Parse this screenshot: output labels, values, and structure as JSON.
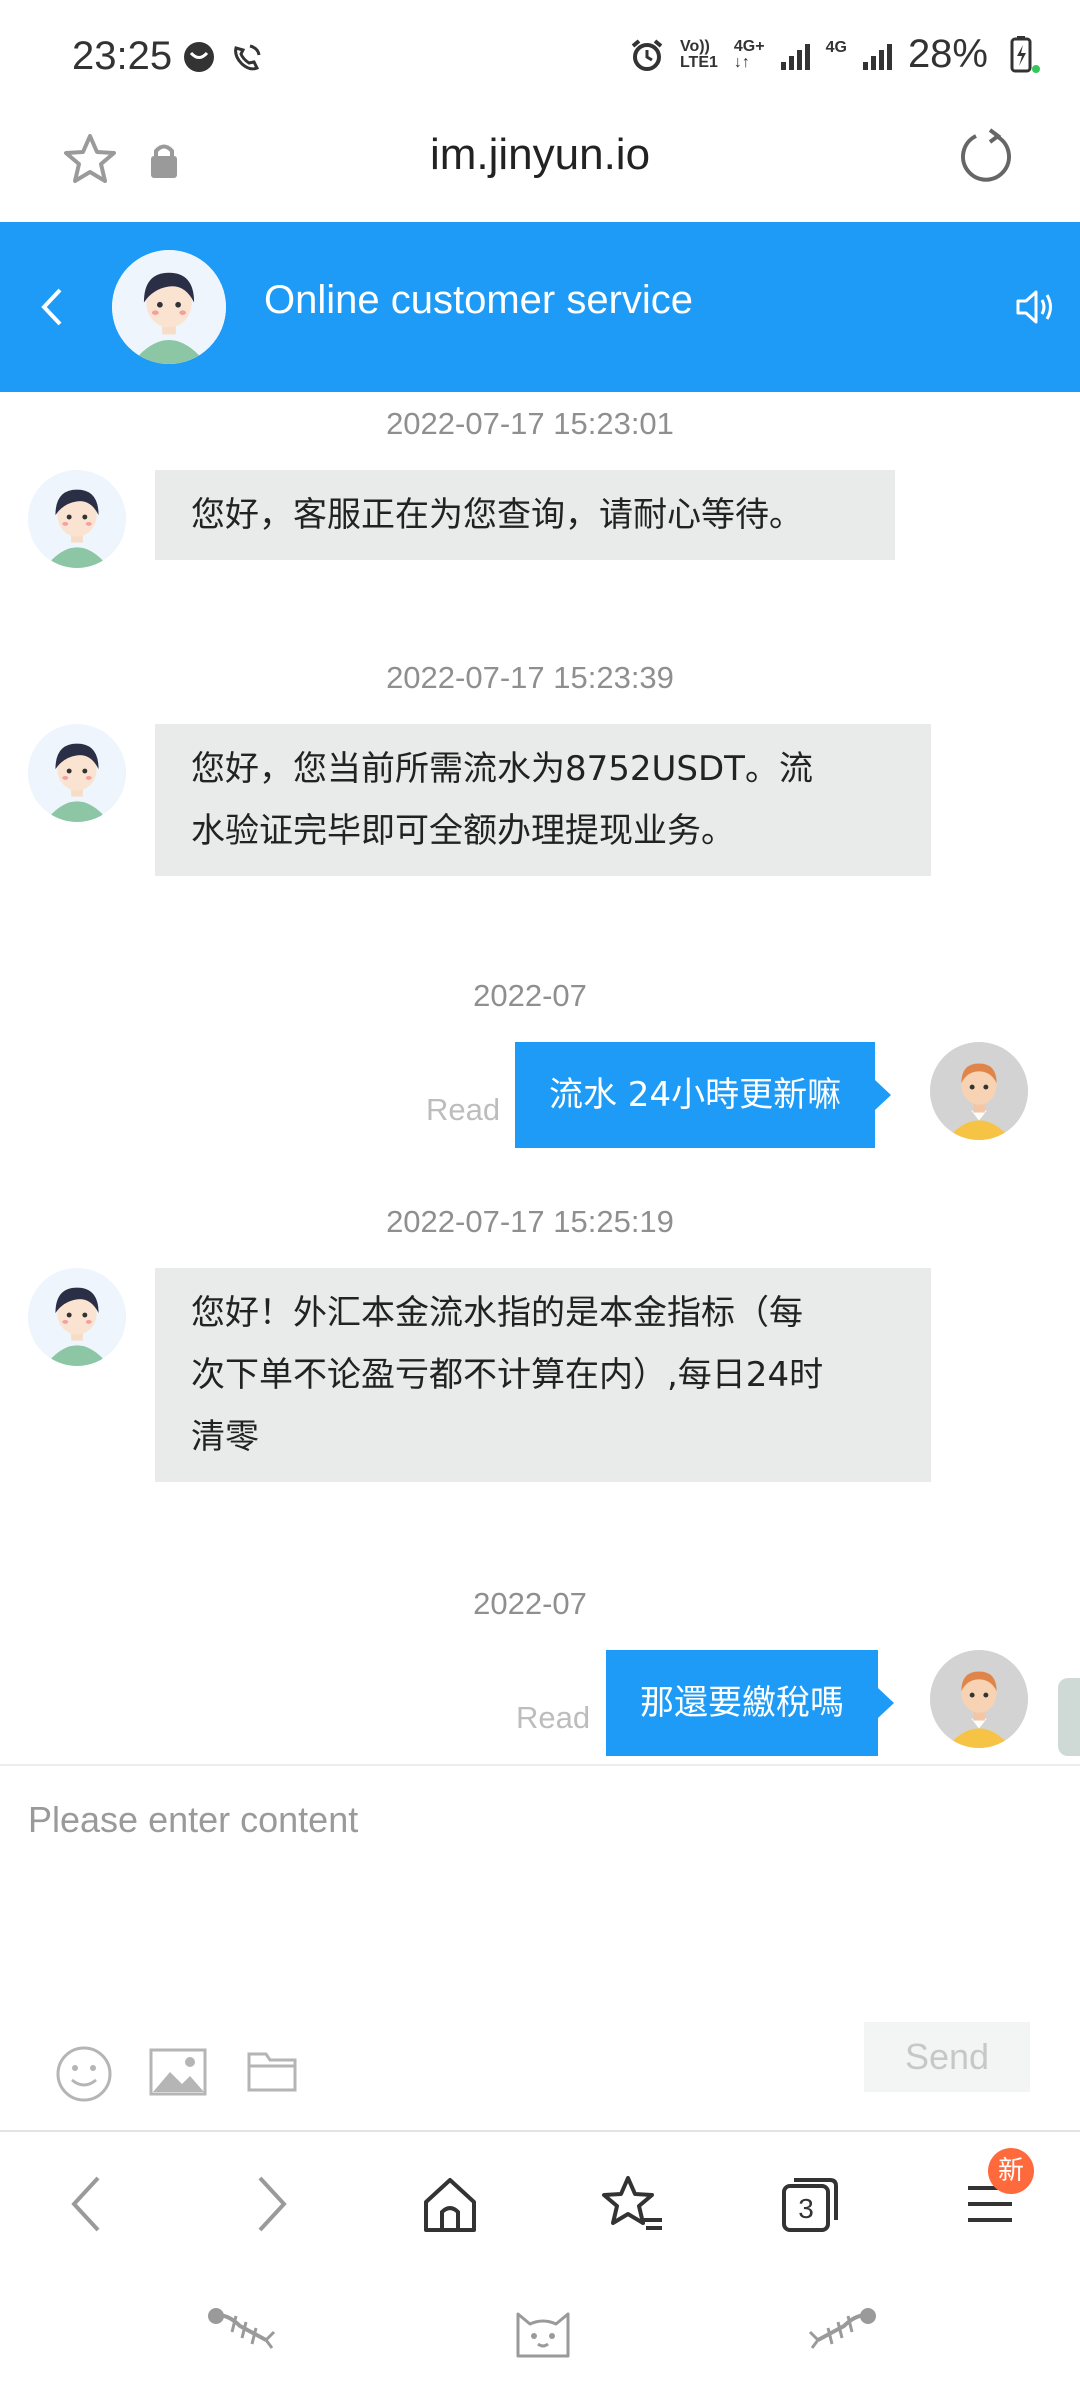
{
  "status_bar": {
    "time": "23:25",
    "network_top": "Vo))",
    "network_bottom": "LTE1",
    "network2": "4G+",
    "network3": "4G",
    "battery": "28%"
  },
  "url_bar": {
    "url": "im.jinyun.io"
  },
  "header": {
    "title": "Online customer service"
  },
  "messages": [
    {
      "from": "agent",
      "timestamp": "2022-07-17 15:23:01",
      "lines": [
        "您好，客服正在为您查询，请耐心等待。"
      ]
    },
    {
      "from": "agent",
      "timestamp": "2022-07-17 15:23:39",
      "lines": [
        "您好，您当前所需流水为8752USDT。流",
        "水验证完毕即可全额办理提现业务。"
      ]
    },
    {
      "from": "user",
      "timestamp": "2022-07",
      "lines": [
        "流水 24小時更新嘛"
      ],
      "status": "Read"
    },
    {
      "from": "agent",
      "timestamp": "2022-07-17 15:25:19",
      "lines": [
        "您好！外汇本金流水指的是本金指标（每",
        "次下单不论盈亏都不计算在内）,每日24时",
        "清零"
      ]
    },
    {
      "from": "user",
      "timestamp": "2022-07",
      "lines": [
        "那還要繳稅嗎"
      ],
      "status": "Read"
    }
  ],
  "composer": {
    "placeholder": "Please enter content",
    "send_label": "Send",
    "icons": [
      "smiley-icon",
      "image-icon",
      "folder-icon"
    ]
  },
  "browser_nav": {
    "tabs_count": "3",
    "badge": "新",
    "icons": [
      "back-icon",
      "forward-icon",
      "home-icon",
      "bookmarks-icon",
      "tabs-icon",
      "menu-icon"
    ]
  },
  "theme_icons": [
    "fishbone-icon",
    "cat-face-icon",
    "fishbone-icon"
  ],
  "colors": {
    "accent": "#1e9bf7",
    "bubble_incoming": "#e9ebeb",
    "badge": "#ff6a3d"
  }
}
